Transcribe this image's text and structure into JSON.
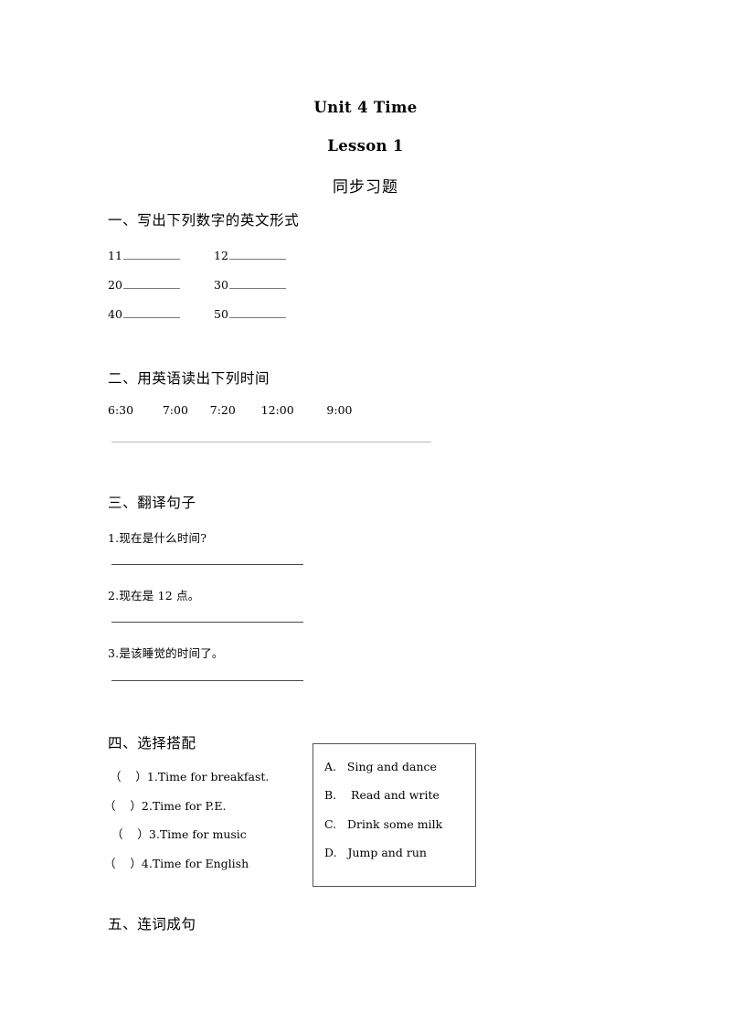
{
  "document": {
    "title_unit": "Unit 4 Time",
    "title_lesson": "Lesson 1",
    "subtitle": "同步习题"
  },
  "sections": {
    "one": {
      "heading": "一、写出下列数字的英文形式",
      "items": [
        {
          "number": "11"
        },
        {
          "number": "12"
        },
        {
          "number": "20"
        },
        {
          "number": "30"
        },
        {
          "number": "40"
        },
        {
          "number": "50"
        }
      ]
    },
    "two": {
      "heading": "二、用英语读出下列时间",
      "times": [
        "6:30",
        "7:00",
        "7:20",
        "12:00",
        "9:00"
      ],
      "times_line": "6:30        7:00      7:20       12:00         9:00"
    },
    "three": {
      "heading": "三、翻译句子",
      "sentences": [
        "1.现在是什么时间?",
        "2.现在是 12 点。",
        "3.是该睡觉的时间了。"
      ]
    },
    "four": {
      "heading": "四、选择搭配",
      "items": [
        "（    ）1.Time for breakfast.",
        "（    ）2.Time for P.E.",
        "（    ）3.Time for music",
        "（    ）4.Time for English"
      ],
      "options": [
        "A.   Sing and dance",
        "B.    Read and write",
        "C.   Drink some milk",
        "D.   Jump and run"
      ]
    },
    "five": {
      "heading": "五、连词成句"
    }
  }
}
